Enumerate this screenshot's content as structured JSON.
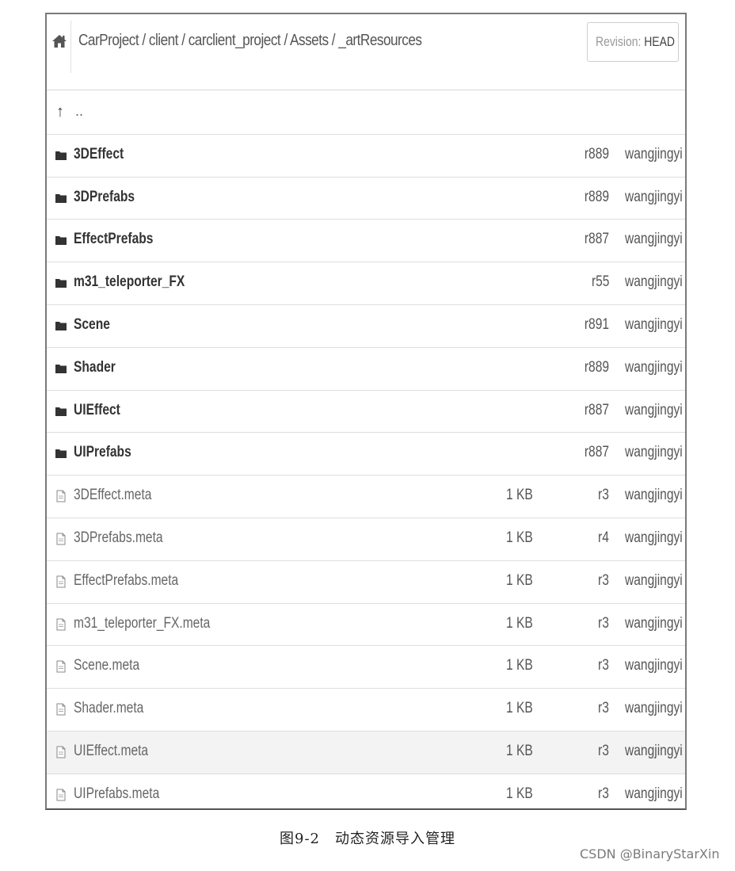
{
  "header": {
    "breadcrumb": "CarProject / client / carclient_project / Assets / _artResources",
    "revision_label": "Revision:",
    "revision_value": "HEAD",
    "home_icon": "home-icon"
  },
  "parent_row": {
    "label": ".."
  },
  "rows": [
    {
      "type": "folder",
      "name": "3DEffect",
      "size": "",
      "rev": "r889",
      "author": "wangjingyi"
    },
    {
      "type": "folder",
      "name": "3DPrefabs",
      "size": "",
      "rev": "r889",
      "author": "wangjingyi"
    },
    {
      "type": "folder",
      "name": "EffectPrefabs",
      "size": "",
      "rev": "r887",
      "author": "wangjingyi"
    },
    {
      "type": "folder",
      "name": "m31_teleporter_FX",
      "size": "",
      "rev": "r55",
      "author": "wangjingyi"
    },
    {
      "type": "folder",
      "name": "Scene",
      "size": "",
      "rev": "r891",
      "author": "wangjingyi"
    },
    {
      "type": "folder",
      "name": "Shader",
      "size": "",
      "rev": "r889",
      "author": "wangjingyi"
    },
    {
      "type": "folder",
      "name": "UIEffect",
      "size": "",
      "rev": "r887",
      "author": "wangjingyi"
    },
    {
      "type": "folder",
      "name": "UIPrefabs",
      "size": "",
      "rev": "r887",
      "author": "wangjingyi"
    },
    {
      "type": "file",
      "name": "3DEffect.meta",
      "size": "1 KB",
      "rev": "r3",
      "author": "wangjingyi"
    },
    {
      "type": "file",
      "name": "3DPrefabs.meta",
      "size": "1 KB",
      "rev": "r4",
      "author": "wangjingyi"
    },
    {
      "type": "file",
      "name": "EffectPrefabs.meta",
      "size": "1 KB",
      "rev": "r3",
      "author": "wangjingyi"
    },
    {
      "type": "file",
      "name": "m31_teleporter_FX.meta",
      "size": "1 KB",
      "rev": "r3",
      "author": "wangjingyi"
    },
    {
      "type": "file",
      "name": "Scene.meta",
      "size": "1 KB",
      "rev": "r3",
      "author": "wangjingyi"
    },
    {
      "type": "file",
      "name": "Shader.meta",
      "size": "1 KB",
      "rev": "r3",
      "author": "wangjingyi"
    },
    {
      "type": "file",
      "name": "UIEffect.meta",
      "size": "1 KB",
      "rev": "r3",
      "author": "wangjingyi",
      "highlight": true
    },
    {
      "type": "file",
      "name": "UIPrefabs.meta",
      "size": "1 KB",
      "rev": "r3",
      "author": "wangjingyi"
    }
  ],
  "caption": "图9-2　动态资源导入管理",
  "watermark": "CSDN @BinaryStarXin"
}
